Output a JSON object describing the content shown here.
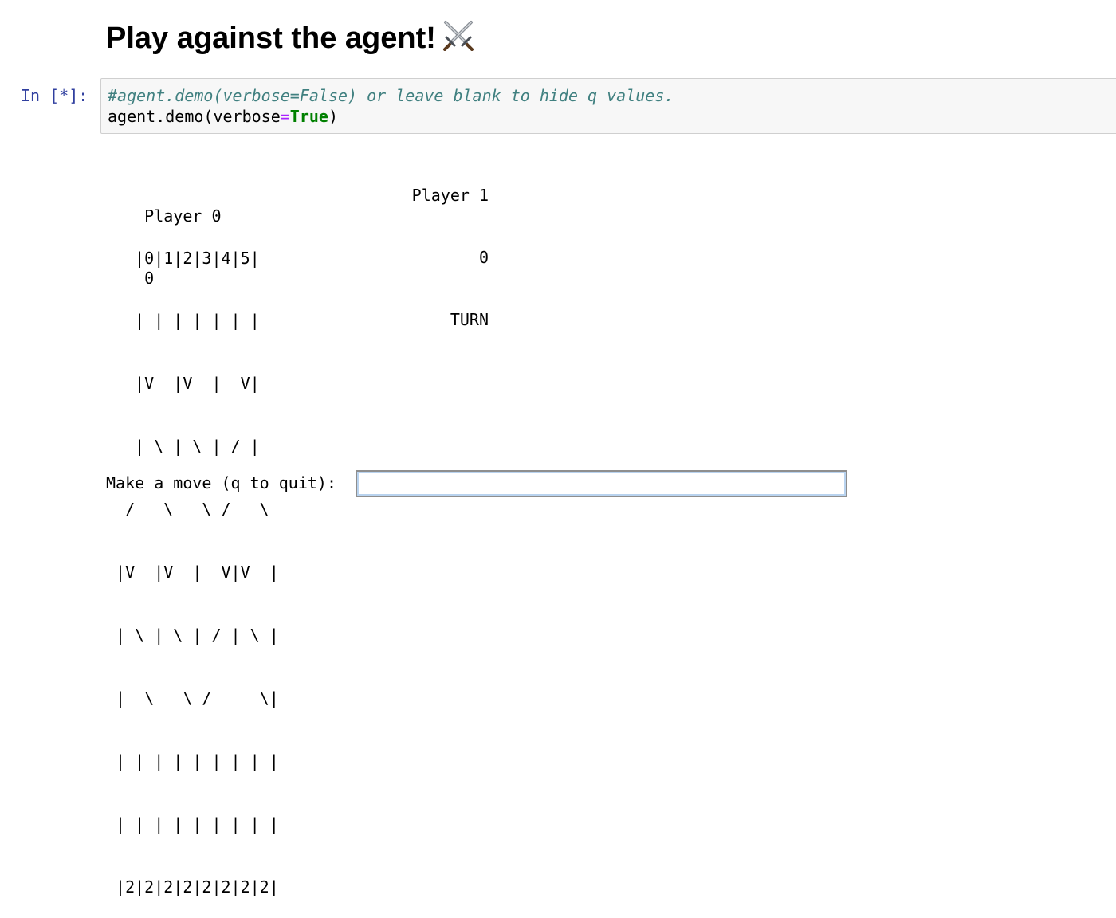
{
  "heading": {
    "text": "Play against the agent!",
    "icon": "crossed-swords-icon"
  },
  "cell": {
    "prompt": "In [*]:",
    "code": {
      "line1_comment": "#agent.demo(verbose=False) or leave blank to hide q values.",
      "line2_call": "agent.demo(verbose",
      "line2_op": "=",
      "line2_kw": "True",
      "line2_close": ")"
    }
  },
  "output": {
    "player0_label": "Player 0",
    "player1_label": "Player 1",
    "player0_score": "0",
    "player1_score": "0",
    "turn_label": "TURN",
    "board_lines": [
      "   |0|1|2|3|4|5|",
      "   | | | | | | |",
      "   |V  |V  |  V|",
      "   | \\ | \\ | / |",
      "  /   \\   \\ /   \\",
      " |V  |V  |  V|V  |",
      " | \\ | \\ | / | \\ |",
      " |  \\   \\ /     \\|",
      " | | | | | | | | |",
      " | | | | | | | | |",
      " |2|2|2|2|2|2|2|2|"
    ]
  },
  "move_prompt": {
    "label": "Make a move (q to quit):",
    "value": ""
  }
}
